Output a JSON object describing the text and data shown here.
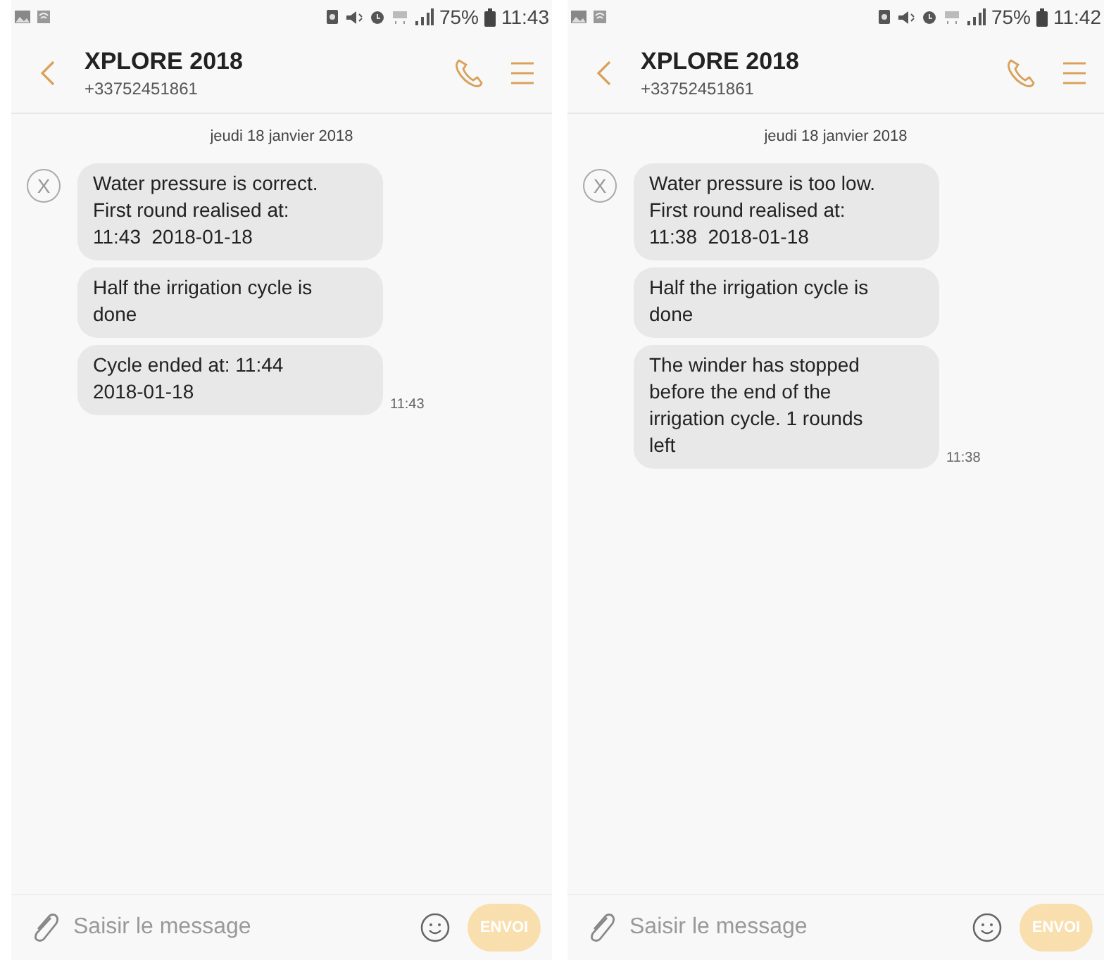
{
  "screens": [
    {
      "status_bar": {
        "battery": "75%",
        "time": "11:43"
      },
      "header": {
        "title": "XPLORE 2018",
        "subtitle": "+33752451861"
      },
      "date": "jeudi 18 janvier 2018",
      "avatar_letter": "X",
      "messages": [
        {
          "text": "Water pressure is correct.\nFirst round realised at:\n11:43  2018-01-18"
        },
        {
          "text": "Half the irrigation cycle is\ndone"
        },
        {
          "text": "Cycle ended at: 11:44\n2018-01-18",
          "time": "11:43"
        }
      ],
      "composer": {
        "placeholder": "Saisir le message",
        "send_label": "ENVOI",
        "send_disabled": true
      }
    },
    {
      "status_bar": {
        "battery": "75%",
        "time": "11:42"
      },
      "header": {
        "title": "XPLORE 2018",
        "subtitle": "+33752451861"
      },
      "date": "jeudi 18 janvier 2018",
      "avatar_letter": "X",
      "messages": [
        {
          "text": "Water pressure is too low.\nFirst round realised at:\n11:38  2018-01-18"
        },
        {
          "text": "Half the irrigation cycle is\ndone"
        },
        {
          "text": "The winder has stopped\nbefore the end of the\nirrigation cycle. 1 rounds\nleft",
          "time": "11:38"
        }
      ],
      "composer": {
        "placeholder": "Saisir le message",
        "send_label": "ENVOI",
        "send_disabled": true
      }
    }
  ]
}
